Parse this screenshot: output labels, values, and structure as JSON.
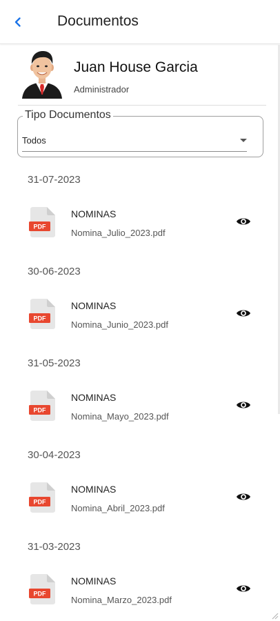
{
  "header": {
    "title": "Documentos",
    "back_icon": "chevron-left-icon",
    "accent_color": "#1a73e8"
  },
  "profile": {
    "name": "Juan House Garcia",
    "role": "Administrador",
    "avatar_icon": "businessman-avatar-icon"
  },
  "filter": {
    "label": "Tipo Documentos",
    "value": "Todos",
    "arrow_icon": "dropdown-arrow-icon"
  },
  "documents": [
    {
      "date": "31-07-2023",
      "category": "NOMINAS",
      "file": "Nomina_Julio_2023.pdf"
    },
    {
      "date": "30-06-2023",
      "category": "NOMINAS",
      "file": "Nomina_Junio_2023.pdf"
    },
    {
      "date": "31-05-2023",
      "category": "NOMINAS",
      "file": "Nomina_Mayo_2023.pdf"
    },
    {
      "date": "30-04-2023",
      "category": "NOMINAS",
      "file": "Nomina_Abril_2023.pdf"
    },
    {
      "date": "31-03-2023",
      "category": "NOMINAS",
      "file": "Nomina_Marzo_2023.pdf"
    }
  ],
  "icons": {
    "file": "pdf-file-icon",
    "view": "eye-icon",
    "pdf_badge_text": "PDF",
    "pdf_color": "#e8472f"
  }
}
